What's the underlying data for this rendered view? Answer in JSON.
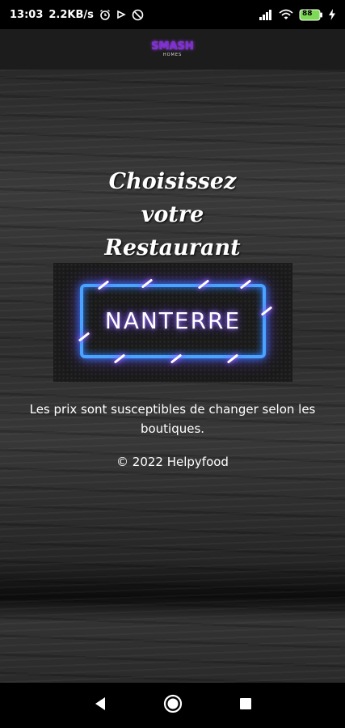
{
  "status_bar": {
    "time": "13:03",
    "speed": "2.2KB/s",
    "battery": "88",
    "icons": [
      "alarm-icon",
      "play-icon",
      "vpn-icon",
      "signal-icon",
      "wifi-icon",
      "battery-icon",
      "charging-icon"
    ]
  },
  "header": {
    "logo_text": "SMASH",
    "logo_sub": "HOMES"
  },
  "main": {
    "title_line1": "Choisissez",
    "title_line2": "votre",
    "title_line3": "Restaurant",
    "restaurant_name": "NANTERRE",
    "notice": "Les prix sont susceptibles de changer selon les boutiques.",
    "copyright": "© 2022 Helpyfood"
  },
  "nav": {
    "icons": [
      "back-icon",
      "home-icon",
      "recents-icon"
    ]
  },
  "colors": {
    "neon_blue": "#4aa3ff",
    "neon_purple": "#8a3bff",
    "logo_purple": "#7b2fd0"
  }
}
